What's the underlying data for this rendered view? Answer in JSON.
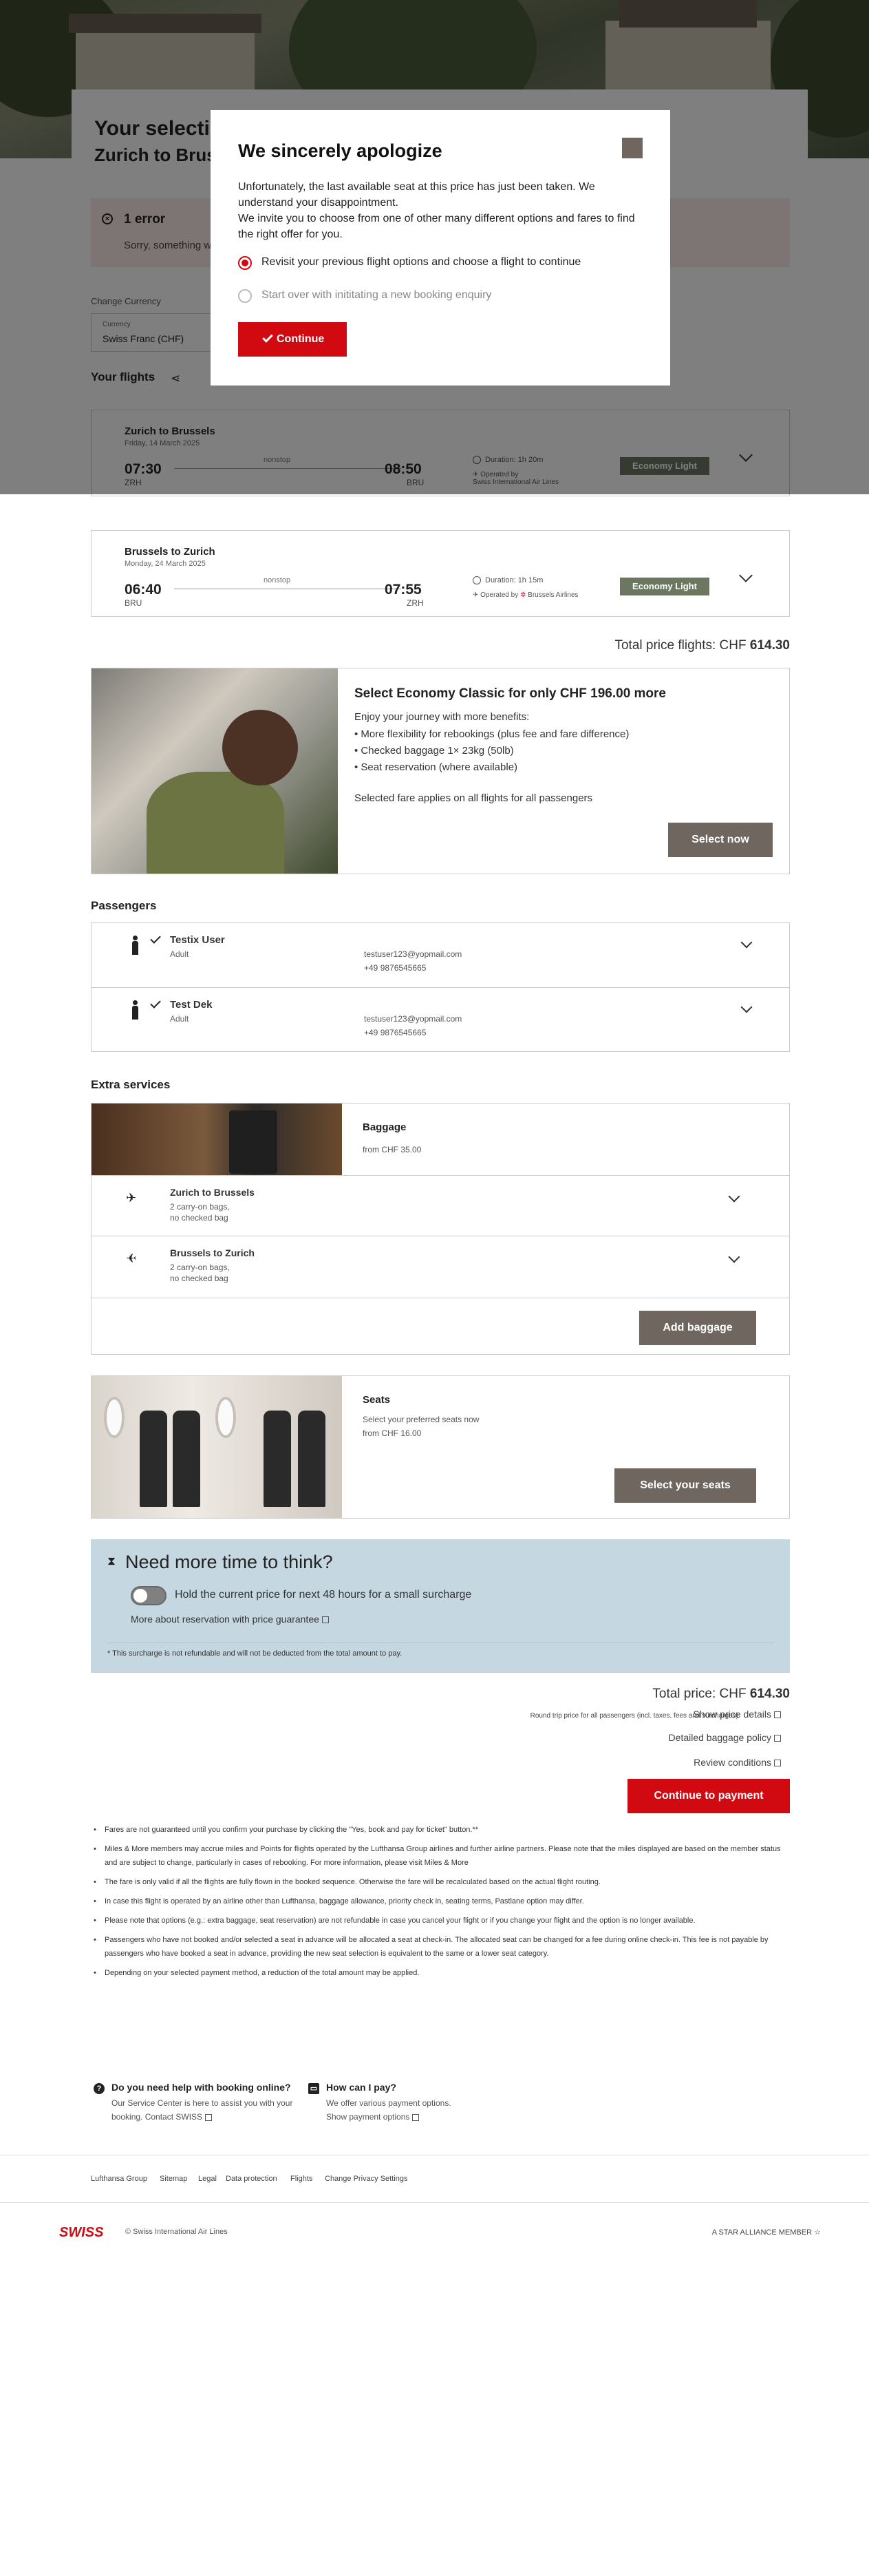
{
  "header": {
    "title": "Your selection",
    "subtitle": "Zurich to Brussels"
  },
  "error": {
    "title": "1 error",
    "text": "Sorry, something went wrong."
  },
  "currency": {
    "label": "Change Currency",
    "small_label": "Currency",
    "value": "Swiss Franc (CHF)"
  },
  "flights_section": {
    "title": "Your flights"
  },
  "flights": [
    {
      "route": "Zurich to Brussels",
      "date": "Friday, 14 March 2025",
      "dep_time": "07:30",
      "dep_code": "ZRH",
      "stops": "nonstop",
      "arr_time": "08:50",
      "arr_code": "BRU",
      "duration": "Duration: 1h 20m",
      "operated": "Operated by",
      "operator": "Swiss International Air Lines",
      "fare": "Economy Light"
    },
    {
      "route": "Brussels to Zurich",
      "date": "Monday, 24 March 2025",
      "dep_time": "06:40",
      "dep_code": "BRU",
      "stops": "nonstop",
      "arr_time": "07:55",
      "arr_code": "ZRH",
      "duration": "Duration: 1h 15m",
      "operated": "Operated by",
      "operator": "Brussels Airlines",
      "fare": "Economy Light"
    }
  ],
  "total_flights": {
    "label": "Total price flights: CHF",
    "amount": "614.30"
  },
  "upsell": {
    "title": "Select Economy Classic for only CHF 196.00 more",
    "intro": "Enjoy your journey with more benefits:",
    "benefits": [
      "• More flexibility for rebookings (plus fee and fare difference)",
      "• Checked baggage 1× 23kg (50lb)",
      "• Seat reservation (where available)"
    ],
    "note": "Selected fare applies on all flights for all passengers",
    "button": "Select now"
  },
  "passengers_section": {
    "title": "Passengers"
  },
  "passengers": [
    {
      "name": "Testix User",
      "type": "Adult",
      "email": "testuser123@yopmail.com",
      "phone": "+49 9876545665"
    },
    {
      "name": "Test Dek",
      "type": "Adult",
      "email": "testuser123@yopmail.com",
      "phone": "+49 9876545665"
    }
  ],
  "extras_section": {
    "title": "Extra services"
  },
  "baggage": {
    "title": "Baggage",
    "from": "from CHF 35.00",
    "legs": [
      {
        "route": "Zurich to Brussels",
        "line1": "2 carry-on bags,",
        "line2": "no checked bag"
      },
      {
        "route": "Brussels to Zurich",
        "line1": "2 carry-on bags,",
        "line2": "no checked bag"
      }
    ],
    "button": "Add baggage"
  },
  "seats": {
    "title": "Seats",
    "sub": "Select your preferred seats now",
    "from": "from CHF 16.00",
    "button": "Select your seats"
  },
  "think": {
    "title": "Need more time to think?",
    "toggle_label": "Hold the current price for next 48 hours for a small surcharge",
    "link": "More about reservation with price guarantee",
    "note": "* This surcharge is not refundable and will not be deducted from the total amount to pay."
  },
  "total": {
    "label": "Total price: CHF",
    "amount": "614.30",
    "sub": "Round trip price for all passengers (incl. taxes, fees and surcharges)",
    "details": "Show price details",
    "baggage_policy": "Detailed baggage policy",
    "conditions": "Review conditions",
    "pay_button": "Continue to payment"
  },
  "notes": [
    "Fares are not guaranteed until you confirm your purchase by clicking the \"Yes, book and pay for ticket\" button.**",
    "Miles & More members may accrue miles and Points for flights operated by the Lufthansa Group airlines and further airline partners. Please note that the miles displayed are based on the member status and are subject to change, particularly in cases of rebooking. For more information, please visit Miles & More",
    "The fare is only valid if all the flights are fully flown in the booked sequence. Otherwise the fare will be recalculated based on the actual flight routing.",
    "In case this flight is operated by an airline other than Lufthansa, baggage allowance, priority check in, seating terms, Pastlane option may differ.",
    "Please note that options (e.g.: extra baggage, seat reservation) are not refundable in case you cancel your flight or if you change your flight and the option is no longer available.",
    "Passengers who have not booked and/or selected a seat in advance will be allocated a seat at check-in. The allocated seat can be changed for a fee during online check-in. This fee is not payable by passengers who have booked a seat in advance, providing the new seat selection is equivalent to the same or a lower seat category.",
    "Depending on your selected payment method, a reduction of the total amount may be applied."
  ],
  "help": [
    {
      "title": "Do you need help with booking online?",
      "line1": "Our Service Center is here to assist you with your",
      "line2": "booking. Contact SWISS"
    },
    {
      "title": "How can I pay?",
      "line1": "We offer various payment options.",
      "line2": "Show payment options"
    }
  ],
  "footer_links": [
    "Lufthansa Group",
    "Sitemap",
    "Legal",
    "Data protection",
    "Flights",
    "Change Privacy Settings"
  ],
  "brand": {
    "name": "SWISS",
    "copyright": "© Swiss International Air Lines",
    "alliance": "A STAR ALLIANCE MEMBER"
  },
  "modal": {
    "title": "We sincerely apologize",
    "line1": "Unfortunately, the last available seat at this price has just been taken. We understand your disappointment.",
    "line2": "We invite you to choose from one of other many different options and fares to find the right offer for you.",
    "option1": "Revisit your previous flight options and choose a flight to continue",
    "option2": "Start over with inititating a new booking enquiry",
    "button": "Continue"
  },
  "colors": {
    "brand_red": "#d10a11",
    "fare_badge": "#6b7760",
    "button_grey": "#6e665f",
    "think_bg": "#c5d7e1"
  }
}
